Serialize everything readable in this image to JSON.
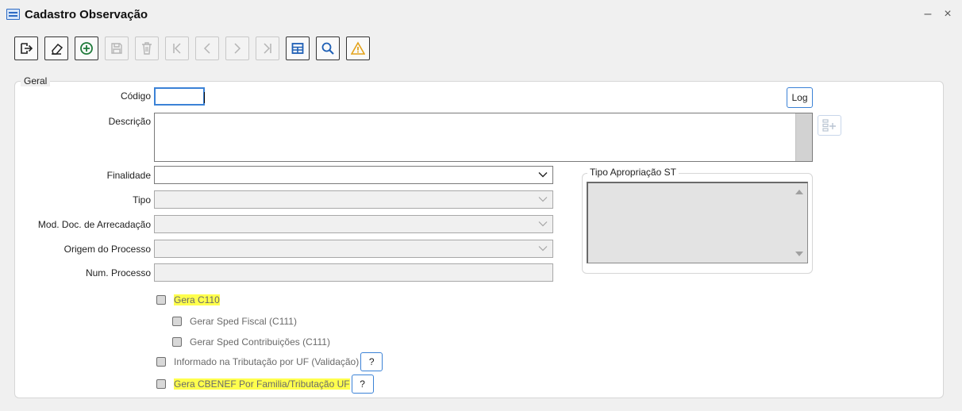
{
  "window": {
    "title": "Cadastro Observação",
    "minimize_glyph": "–",
    "close_glyph": "×"
  },
  "toolbar": {
    "buttons": [
      {
        "name": "exit-icon",
        "enabled": true
      },
      {
        "name": "eraser-icon",
        "enabled": true
      },
      {
        "name": "add-icon",
        "enabled": true
      },
      {
        "name": "save-icon",
        "enabled": false
      },
      {
        "name": "delete-icon",
        "enabled": false
      },
      {
        "name": "first-record-icon",
        "enabled": false
      },
      {
        "name": "previous-record-icon",
        "enabled": false
      },
      {
        "name": "next-record-icon",
        "enabled": false
      },
      {
        "name": "last-record-icon",
        "enabled": false
      },
      {
        "name": "grid-icon",
        "enabled": true
      },
      {
        "name": "search-icon",
        "enabled": true
      },
      {
        "name": "warning-icon",
        "enabled": true
      }
    ]
  },
  "form": {
    "group_title": "Geral",
    "codigo_label": "Código",
    "codigo_value": "",
    "log_button": "Log",
    "descricao_label": "Descrição",
    "descricao_value": "",
    "finalidade_label": "Finalidade",
    "finalidade_value": "",
    "tipo_label": "Tipo",
    "tipo_value": "",
    "mod_doc_label": "Mod. Doc. de Arrecadação",
    "mod_doc_value": "",
    "origem_label": "Origem do Processo",
    "origem_value": "",
    "num_processo_label": "Num. Processo",
    "num_processo_value": ""
  },
  "tipo_apropriacao": {
    "title": "Tipo Apropriação ST"
  },
  "checkboxes": {
    "gera_c110": "Gera C110",
    "gerar_sped_fiscal": "Gerar Sped Fiscal (C111)",
    "gerar_sped_contribuicoes": "Gerar Sped Contribuições (C111)",
    "informado_tributacao": "Informado na Tributação por UF (Validação)",
    "gera_cbenef": "Gera CBENEF Por Familia/Tributação UF",
    "help_label": "?"
  },
  "colors": {
    "highlight": "#ffff4d",
    "accent_border": "#3b82d6",
    "add_icon": "#1f7a3a",
    "grid_icon": "#1e5fb5",
    "search_icon": "#1e5fb5",
    "warning_icon": "#e3a21a"
  }
}
